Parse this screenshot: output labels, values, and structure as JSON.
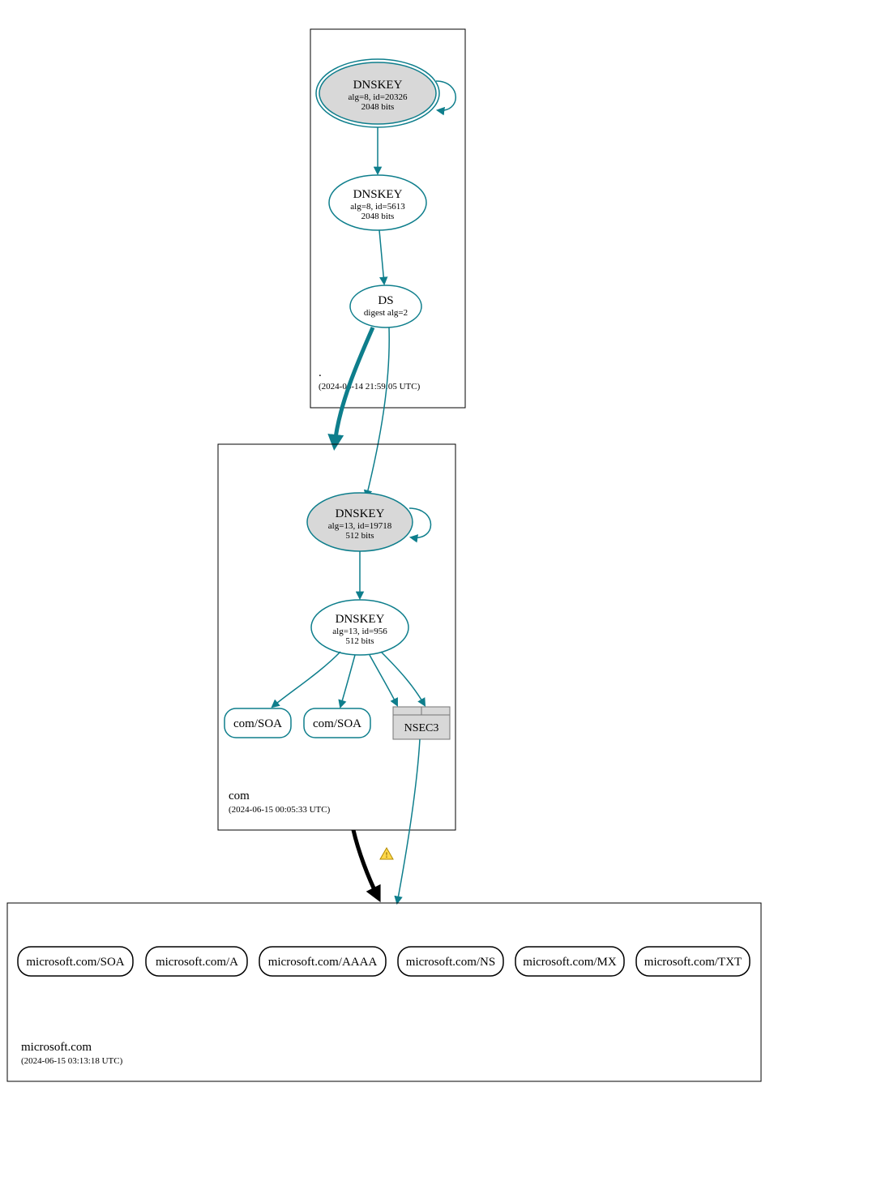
{
  "colors": {
    "teal": "#0e7e8c",
    "node_fill_ksk": "#d8d8d8",
    "node_fill": "#ffffff",
    "border_black": "#000000",
    "nsec3_fill": "#d8d8d8",
    "nsec3_stroke": "#757575"
  },
  "zones": {
    "root": {
      "name": ".",
      "timestamp": "(2024-06-14 21:59:05 UTC)",
      "nodes": {
        "ksk": {
          "title": "DNSKEY",
          "line1": "alg=8, id=20326",
          "line2": "2048 bits",
          "double_ring": true,
          "ksk": true,
          "self_loop": true
        },
        "zsk": {
          "title": "DNSKEY",
          "line1": "alg=8, id=5613",
          "line2": "2048 bits"
        },
        "ds": {
          "title": "DS",
          "line1": "digest alg=2"
        }
      }
    },
    "com": {
      "name": "com",
      "timestamp": "(2024-06-15 00:05:33 UTC)",
      "nodes": {
        "ksk": {
          "title": "DNSKEY",
          "line1": "alg=13, id=19718",
          "line2": "512 bits",
          "ksk": true,
          "self_loop": true
        },
        "zsk": {
          "title": "DNSKEY",
          "line1": "alg=13, id=956",
          "line2": "512 bits"
        },
        "soa1": {
          "title": "com/SOA"
        },
        "soa2": {
          "title": "com/SOA"
        },
        "nsec3": {
          "title": "NSEC3"
        }
      }
    },
    "microsoft": {
      "name": "microsoft.com",
      "timestamp": "(2024-06-15 03:13:18 UTC)",
      "records": [
        "microsoft.com/SOA",
        "microsoft.com/A",
        "microsoft.com/AAAA",
        "microsoft.com/NS",
        "microsoft.com/MX",
        "microsoft.com/TXT"
      ]
    }
  },
  "warning_icon": "⚠"
}
